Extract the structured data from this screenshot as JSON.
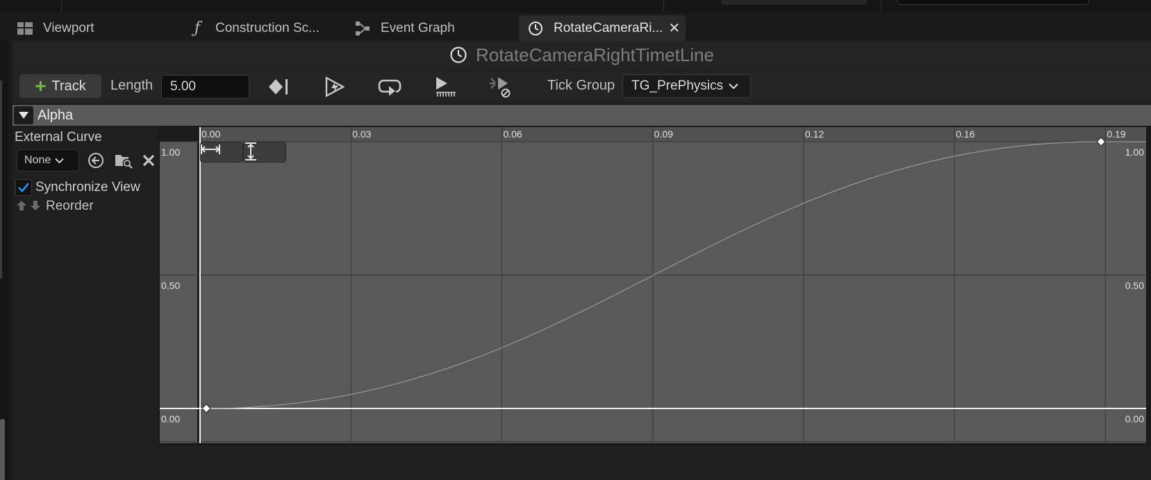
{
  "tabs": [
    {
      "label": "Viewport",
      "icon": "viewport-grid-icon"
    },
    {
      "label": "Construction Sc...",
      "icon": "function-icon"
    },
    {
      "label": "Event Graph",
      "icon": "graph-nodes-icon"
    },
    {
      "label": "RotateCameraRi...",
      "icon": "clock-icon",
      "active": true,
      "close": "✕"
    }
  ],
  "title": {
    "text": "RotateCameraRightTimetLine",
    "icon": "clock-icon"
  },
  "toolbar": {
    "add_track_label": "Track",
    "length_label": "Length",
    "length_value": "5.00",
    "tick_group_label": "Tick Group",
    "tick_group_value": "TG_PrePhysics"
  },
  "track": {
    "name": "Alpha",
    "external_curve_label": "External Curve",
    "external_curve_value": "None",
    "synchronize_view_label": "Synchronize View",
    "synchronize_view_checked": true,
    "reorder_label": "Reorder"
  },
  "chart_data": {
    "type": "line",
    "x_ticks": [
      "0.00",
      "0.03",
      "0.06",
      "0.09",
      "0.12",
      "0.16",
      "0.19"
    ],
    "y_ticks_left": [
      "1.00",
      "0.50",
      "0.00"
    ],
    "y_ticks_right": [
      "1.00",
      "0.50",
      "0.00"
    ],
    "keyframes": [
      {
        "x": 0.0,
        "y": 0.0
      },
      {
        "x": 0.2,
        "y": 1.0
      }
    ],
    "curve": "ease-in-out",
    "xlim": [
      0.0,
      0.21
    ],
    "ylim": [
      0.0,
      1.0
    ],
    "grid": true
  },
  "colors": {
    "accent_green": "#6fbf3a",
    "checkbox_blue": "#2f8fff",
    "curve_bg": "#595959",
    "grid_line": "#3d3d3d"
  }
}
